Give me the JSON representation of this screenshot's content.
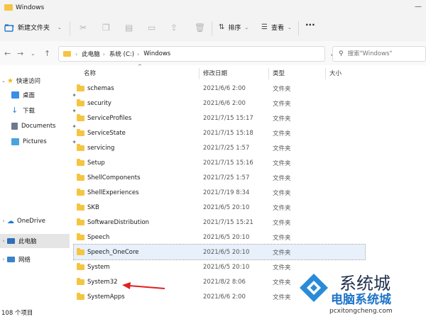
{
  "window": {
    "title": "Windows"
  },
  "toolbar": {
    "new_label": "新建文件夹",
    "sort_label": "排序",
    "view_label": "查看",
    "more_label": "···"
  },
  "nav": {
    "breadcrumbs": [
      "此电脑",
      "系统 (C:)",
      "Windows"
    ],
    "search_placeholder": "搜索\"Windows\""
  },
  "sidebar": {
    "quick_access": "快速访问",
    "items": [
      {
        "label": "桌面",
        "icon": "desktop-icon",
        "pinned": true
      },
      {
        "label": "下载",
        "icon": "download-icon",
        "pinned": true
      },
      {
        "label": "Documents",
        "icon": "documents-icon",
        "pinned": true
      },
      {
        "label": "Pictures",
        "icon": "pictures-icon",
        "pinned": true
      }
    ],
    "onedrive": "OneDrive",
    "this_pc": "此电脑",
    "network": "网络"
  },
  "columns": {
    "name": "名称",
    "date": "修改日期",
    "type": "类型",
    "size": "大小"
  },
  "files": [
    {
      "name": "schemas",
      "date": "2021/6/6 2:00",
      "type": "文件夹"
    },
    {
      "name": "security",
      "date": "2021/6/6 2:00",
      "type": "文件夹"
    },
    {
      "name": "ServiceProfiles",
      "date": "2021/7/15 15:17",
      "type": "文件夹"
    },
    {
      "name": "ServiceState",
      "date": "2021/7/15 15:18",
      "type": "文件夹"
    },
    {
      "name": "servicing",
      "date": "2021/7/25 1:57",
      "type": "文件夹"
    },
    {
      "name": "Setup",
      "date": "2021/7/15 15:16",
      "type": "文件夹"
    },
    {
      "name": "ShellComponents",
      "date": "2021/7/25 1:57",
      "type": "文件夹"
    },
    {
      "name": "ShellExperiences",
      "date": "2021/7/19 8:34",
      "type": "文件夹"
    },
    {
      "name": "SKB",
      "date": "2021/6/5 20:10",
      "type": "文件夹"
    },
    {
      "name": "SoftwareDistribution",
      "date": "2021/7/15 15:21",
      "type": "文件夹"
    },
    {
      "name": "Speech",
      "date": "2021/6/5 20:10",
      "type": "文件夹"
    },
    {
      "name": "Speech_OneCore",
      "date": "2021/6/5 20:10",
      "type": "文件夹"
    },
    {
      "name": "System",
      "date": "2021/6/5 20:10",
      "type": "文件夹"
    },
    {
      "name": "System32",
      "date": "2021/8/2 8:06",
      "type": "文件夹"
    },
    {
      "name": "SystemApps",
      "date": "2021/6/6 2:00",
      "type": "文件夹"
    }
  ],
  "status": {
    "count": "108 个项目"
  },
  "watermark": {
    "title": "系统城",
    "subtitle": "电脑系统城",
    "url": "pcxitongcheng.com"
  },
  "colors": {
    "folder": "#f4c542",
    "selected_row": "#e8f1fb",
    "accent": "#0067c0",
    "arrow": "#e02020"
  }
}
